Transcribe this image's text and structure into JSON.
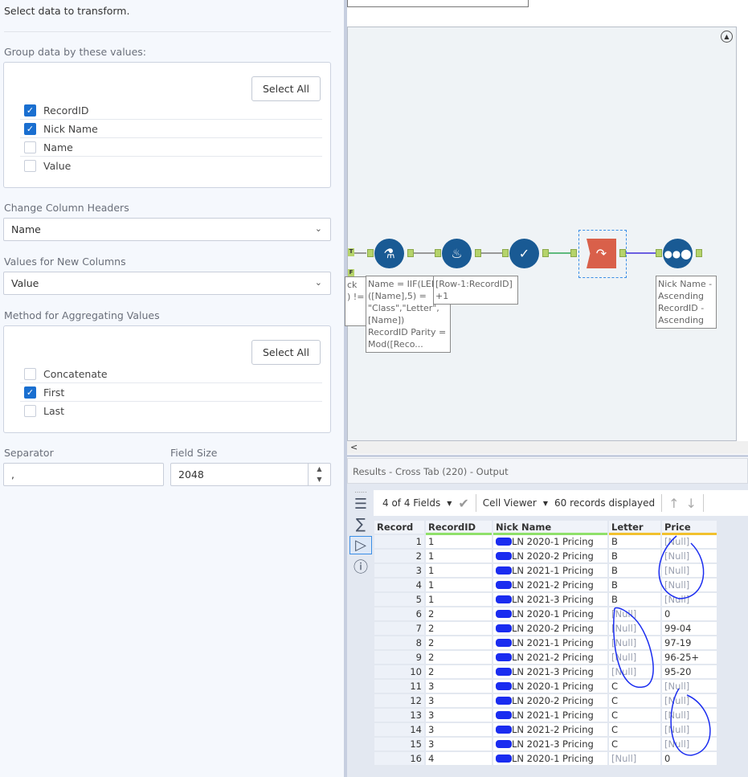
{
  "config": {
    "intro": "Select data to transform.",
    "group_label": "Group data by these values:",
    "select_all": "Select All",
    "group_fields": [
      {
        "label": "RecordID",
        "checked": true
      },
      {
        "label": "Nick Name",
        "checked": true
      },
      {
        "label": "Name",
        "checked": false
      },
      {
        "label": "Value",
        "checked": false
      }
    ],
    "headers_label": "Change Column Headers",
    "headers_value": "Name",
    "values_label": "Values for New Columns",
    "values_value": "Value",
    "method_label": "Method for Aggregating Values",
    "methods": [
      {
        "label": "Concatenate",
        "checked": false
      },
      {
        "label": "First",
        "checked": true
      },
      {
        "label": "Last",
        "checked": false
      }
    ],
    "separator_label": "Separator",
    "separator_value": ",",
    "field_size_label": "Field Size",
    "field_size_value": "2048"
  },
  "workflow": {
    "filter_t": "T",
    "filter_f": "F",
    "filter_ann": [
      "ck",
      ") !="
    ],
    "formula_ann": [
      "Name = IIF(LEF",
      "([Name],5) =",
      "\"Class\",\"Letter\",",
      "[Name])",
      "RecordID Parity =",
      "Mod([Reco..."
    ],
    "multirow_ann": [
      "[Row-1:RecordID]",
      "+1"
    ],
    "sort_ann": [
      "Nick Name -",
      "Ascending",
      "RecordID -",
      "Ascending"
    ],
    "scroll_left": "<"
  },
  "results": {
    "title": "Results - Cross Tab (220) - Output",
    "fields": "4 of 4 Fields",
    "cell_viewer": "Cell Viewer",
    "records": "60 records displayed",
    "columns": [
      "Record",
      "RecordID",
      "Nick Name",
      "Letter",
      "Price"
    ],
    "rows": [
      [
        "1",
        "1",
        "LN 2020-1 Pricing",
        "B",
        "[Null]"
      ],
      [
        "2",
        "1",
        "LN 2020-2 Pricing",
        "B",
        "[Null]"
      ],
      [
        "3",
        "1",
        "LN 2021-1 Pricing",
        "B",
        "[Null]"
      ],
      [
        "4",
        "1",
        "LN 2021-2 Pricing",
        "B",
        "[Null]"
      ],
      [
        "5",
        "1",
        "LN 2021-3 Pricing",
        "B",
        "[Null]"
      ],
      [
        "6",
        "2",
        "LN 2020-1 Pricing",
        "[Null]",
        "0"
      ],
      [
        "7",
        "2",
        "LN 2020-2 Pricing",
        "[Null]",
        "99-04"
      ],
      [
        "8",
        "2",
        "LN 2021-1 Pricing",
        "[Null]",
        "97-19"
      ],
      [
        "9",
        "2",
        "LN 2021-2 Pricing",
        "[Null]",
        "96-25+"
      ],
      [
        "10",
        "2",
        "LN 2021-3 Pricing",
        "[Null]",
        "95-20"
      ],
      [
        "11",
        "3",
        "LN 2020-1 Pricing",
        "C",
        "[Null]"
      ],
      [
        "12",
        "3",
        "LN 2020-2 Pricing",
        "C",
        "[Null]"
      ],
      [
        "13",
        "3",
        "LN 2021-1 Pricing",
        "C",
        "[Null]"
      ],
      [
        "14",
        "3",
        "LN 2021-2 Pricing",
        "C",
        "[Null]"
      ],
      [
        "15",
        "3",
        "LN 2021-3 Pricing",
        "C",
        "[Null]"
      ],
      [
        "16",
        "4",
        "LN 2020-1 Pricing",
        "[Null]",
        "0"
      ]
    ]
  },
  "colors": {
    "accent": "#1a6fd0",
    "node": "#195a94",
    "crosstab": "#d9604a",
    "anchor": "#b5d36b",
    "scribble": "#1a2cf0"
  }
}
